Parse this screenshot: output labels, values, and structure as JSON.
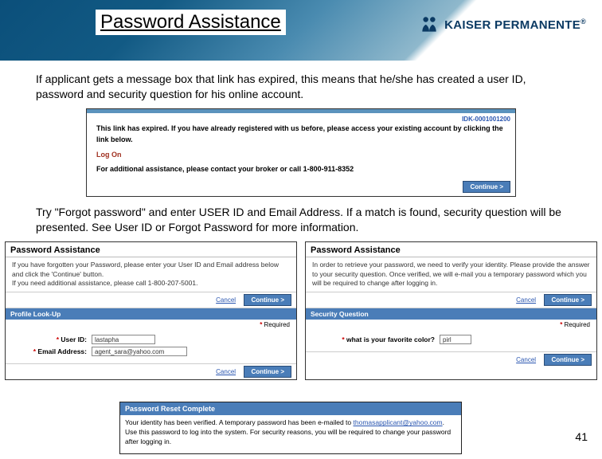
{
  "header": {
    "title": "Password Assistance",
    "brand_name": "KAISER PERMANENTE",
    "brand_suffix": "®"
  },
  "para1": "If applicant gets a message box that link has expired, this means that he/she has created a user ID, password and security question for his online account.",
  "shot1": {
    "ref": "IDK-0001001200",
    "line1": "This link has expired. If you have already registered with us before, please access your existing account by clicking the link below.",
    "link": "Log On",
    "line2": "For additional assistance, please contact your broker or call 1-800-911-8352",
    "continue": "Continue >"
  },
  "para2": "Try \"Forgot password\" and enter USER ID and Email Address. If a match is found, security question will be presented. See User ID or Forgot Password for more information.",
  "left": {
    "title": "Password Assistance",
    "desc": "If you have forgotten your Password, please enter your User ID and Email address below and click the 'Continue' button.",
    "assist": "If you need additional assistance, please call 1-800-207-5001.",
    "cancel": "Cancel",
    "continue": "Continue >",
    "section": "Profile Look-Up",
    "required": "Required",
    "user_label": "User ID:",
    "user_value": "lastapha",
    "email_label": "Email Address:",
    "email_value": "agent_sara@yahoo.com"
  },
  "right": {
    "title": "Password Assistance",
    "desc": "In order to retrieve your password, we need to verify your identity. Please provide the answer to your security question. Once verified, we will e-mail you a temporary password which you will be required to change after logging in.",
    "cancel": "Cancel",
    "continue": "Continue >",
    "section": "Security Question",
    "required": "Required",
    "q_label": "what is your favorite color?",
    "q_value": "pirl"
  },
  "reset": {
    "title": "Password Reset Complete",
    "pre": "Your identity has been verified. A temporary password has been e-mailed to ",
    "email": "thomasapplicant@yahoo.com",
    "post": ". Use this password to log into the system. For security reasons, you will be required to change your password after logging in."
  },
  "page_num": "41"
}
